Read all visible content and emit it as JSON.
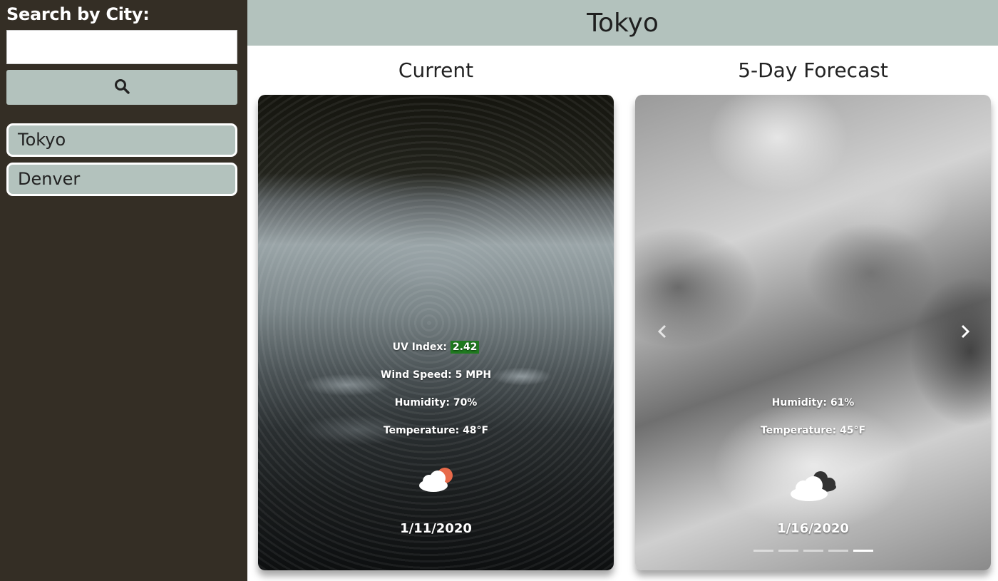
{
  "sidebar": {
    "search_label": "Search by City:",
    "search_value": "",
    "search_placeholder": "",
    "search_button_icon": "search-icon",
    "history": [
      {
        "label": "Tokyo"
      },
      {
        "label": "Denver"
      }
    ]
  },
  "header": {
    "city": "Tokyo"
  },
  "current": {
    "title": "Current",
    "uv_label": "UV Index:",
    "uv_value": "2.42",
    "uv_color": "#1f7a1f",
    "wind": "Wind Speed: 5 MPH",
    "humidity": "Humidity: 70%",
    "temperature": "Temperature: 48°F",
    "icon": "partly-cloudy-icon",
    "date": "1/11/2020"
  },
  "forecast": {
    "title": "5-Day Forecast",
    "humidity": "Humidity: 61%",
    "temperature": "Temperature: 45°F",
    "icon": "cloudy-icon",
    "date": "1/16/2020",
    "slide_count": 5,
    "active_slide": 5
  },
  "colors": {
    "sidebar_bg": "#342e25",
    "accent": "#b3c2bd"
  }
}
